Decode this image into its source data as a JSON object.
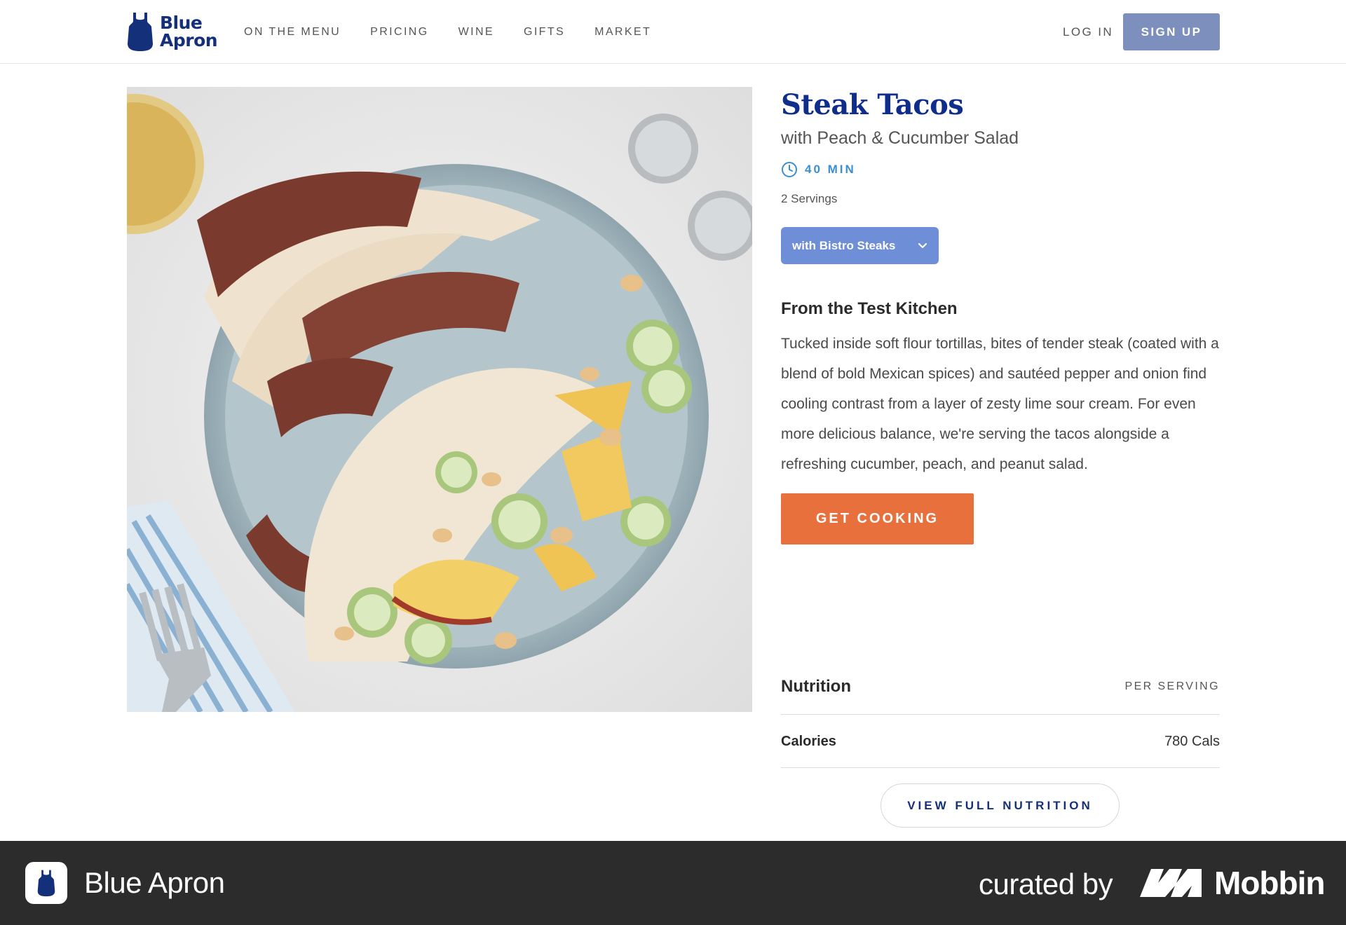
{
  "header": {
    "logo": {
      "line1": "Blue",
      "line2": "Apron",
      "icon": "apron-logo-icon"
    },
    "nav": [
      "ON THE MENU",
      "PRICING",
      "WINE",
      "GIFTS",
      "MARKET"
    ],
    "login_label": "LOG IN",
    "signup_label": "SIGN UP"
  },
  "recipe": {
    "title": "Steak Tacos",
    "subtitle": "with Peach & Cucumber Salad",
    "time": "40 MIN",
    "servings": "2 Servings",
    "variant": "with Bistro Steaks",
    "section_title": "From the Test Kitchen",
    "description": "Tucked inside soft flour tortillas, bites of tender steak (coated with a blend of bold Mexican spices) and sautéed pepper and onion find cooling contrast from a layer of zesty lime sour cream. For even more delicious balance, we're serving the tacos alongside a refreshing cucumber, peach, and peanut salad.",
    "cta_label": "GET COOKING"
  },
  "nutrition": {
    "title": "Nutrition",
    "per_serving": "PER SERVING",
    "calories_label": "Calories",
    "calories_value": "780 Cals",
    "view_full_label": "VIEW FULL NUTRITION"
  },
  "footer": {
    "app_name": "Blue Apron",
    "curated_by": "curated by",
    "brand": "Mobbin"
  },
  "colors": {
    "brand_navy": "#14307a",
    "title_blue": "#0f2d8a",
    "time_blue": "#3b8fd1",
    "signup_bg": "#7c8fbd",
    "variant_bg": "#6e8fd8",
    "cta_orange": "#e8703d",
    "footer_bg": "#2c2c2c"
  }
}
